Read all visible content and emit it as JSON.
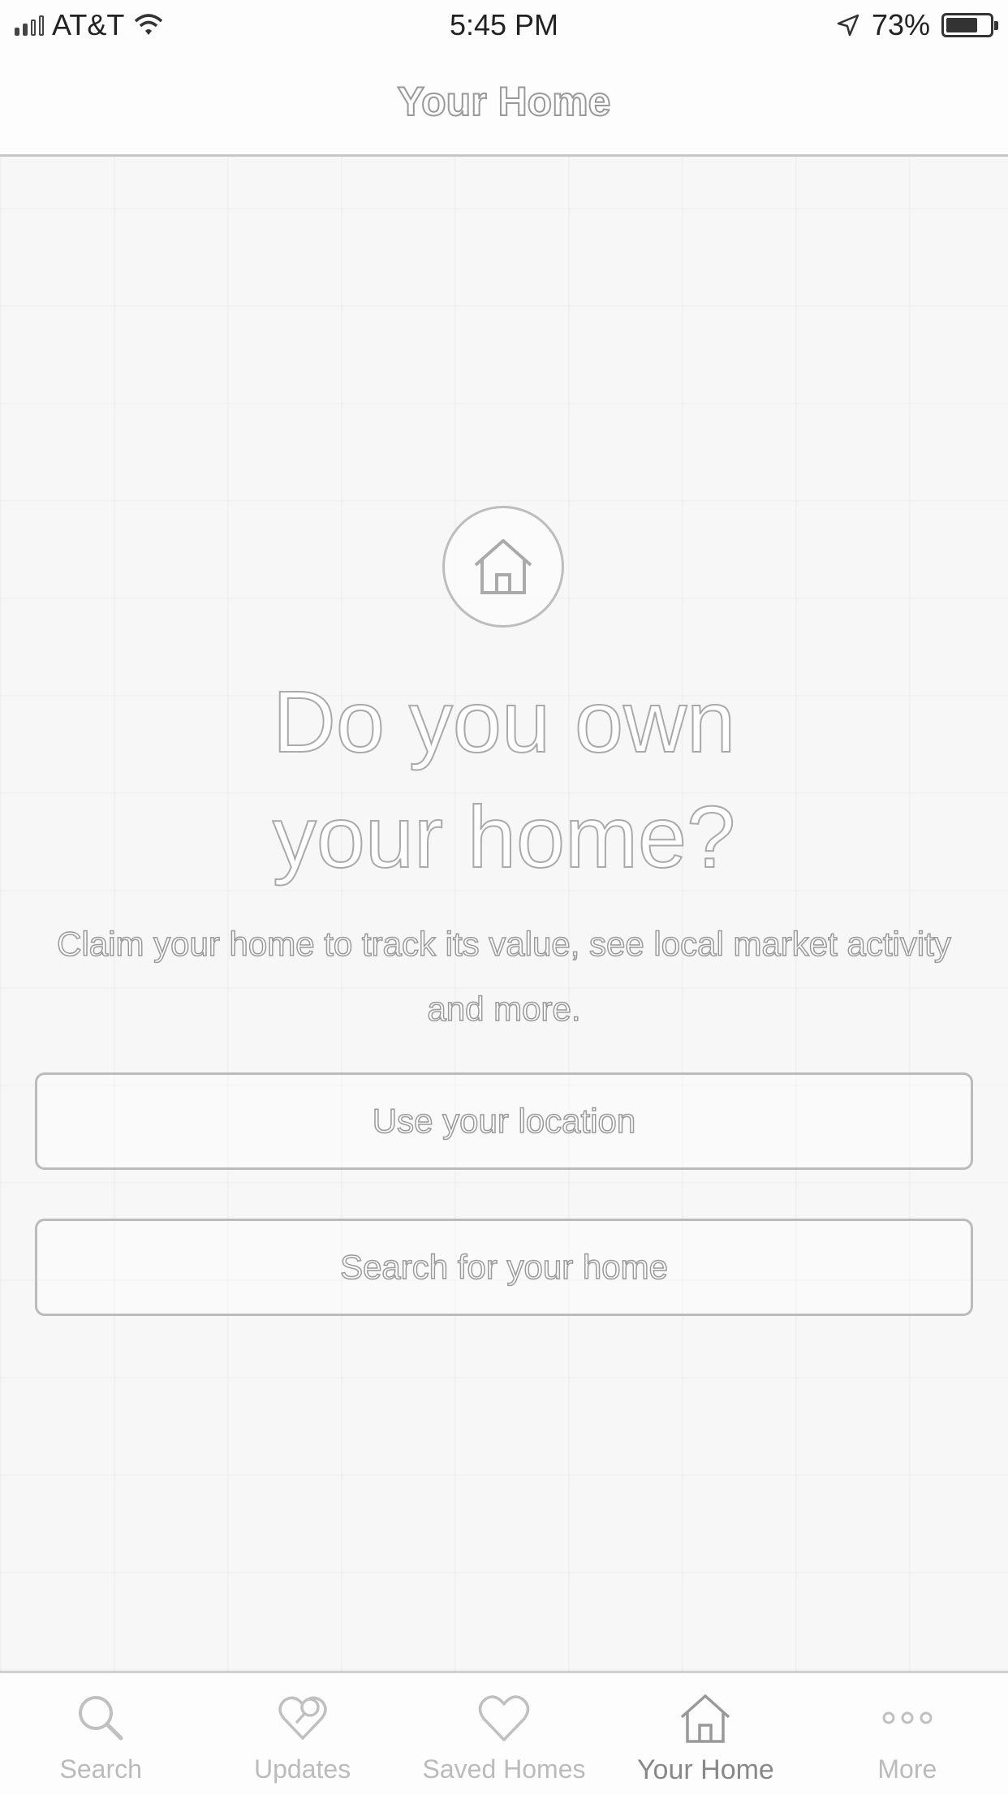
{
  "status_bar": {
    "carrier": "AT&T",
    "time": "5:45 PM",
    "battery_percent": "73%",
    "battery_level": 0.73,
    "icons": [
      "signal-icon",
      "wifi-icon",
      "location-arrow-icon",
      "battery-icon"
    ]
  },
  "header": {
    "title": "Your Home"
  },
  "main": {
    "badge_icon": "house-icon",
    "headline_line1": "Do you own",
    "headline_line2": "your home?",
    "subtext": "Claim your home to track its value, see local market activity and more.",
    "buttons": {
      "use_location": "Use your location",
      "search_home": "Search for your home"
    }
  },
  "tab_bar": {
    "active": "Your Home",
    "tabs": [
      {
        "label": "Search",
        "icon": "search-icon"
      },
      {
        "label": "Updates",
        "icon": "heart-search-icon"
      },
      {
        "label": "Saved Homes",
        "icon": "heart-icon"
      },
      {
        "label": "Your Home",
        "icon": "house-icon"
      },
      {
        "label": "More",
        "icon": "more-dots-icon"
      }
    ]
  },
  "colors": {
    "divider": "#c8c8c8",
    "icon_gray": "#bbbbbb",
    "active_gray": "#888888"
  }
}
